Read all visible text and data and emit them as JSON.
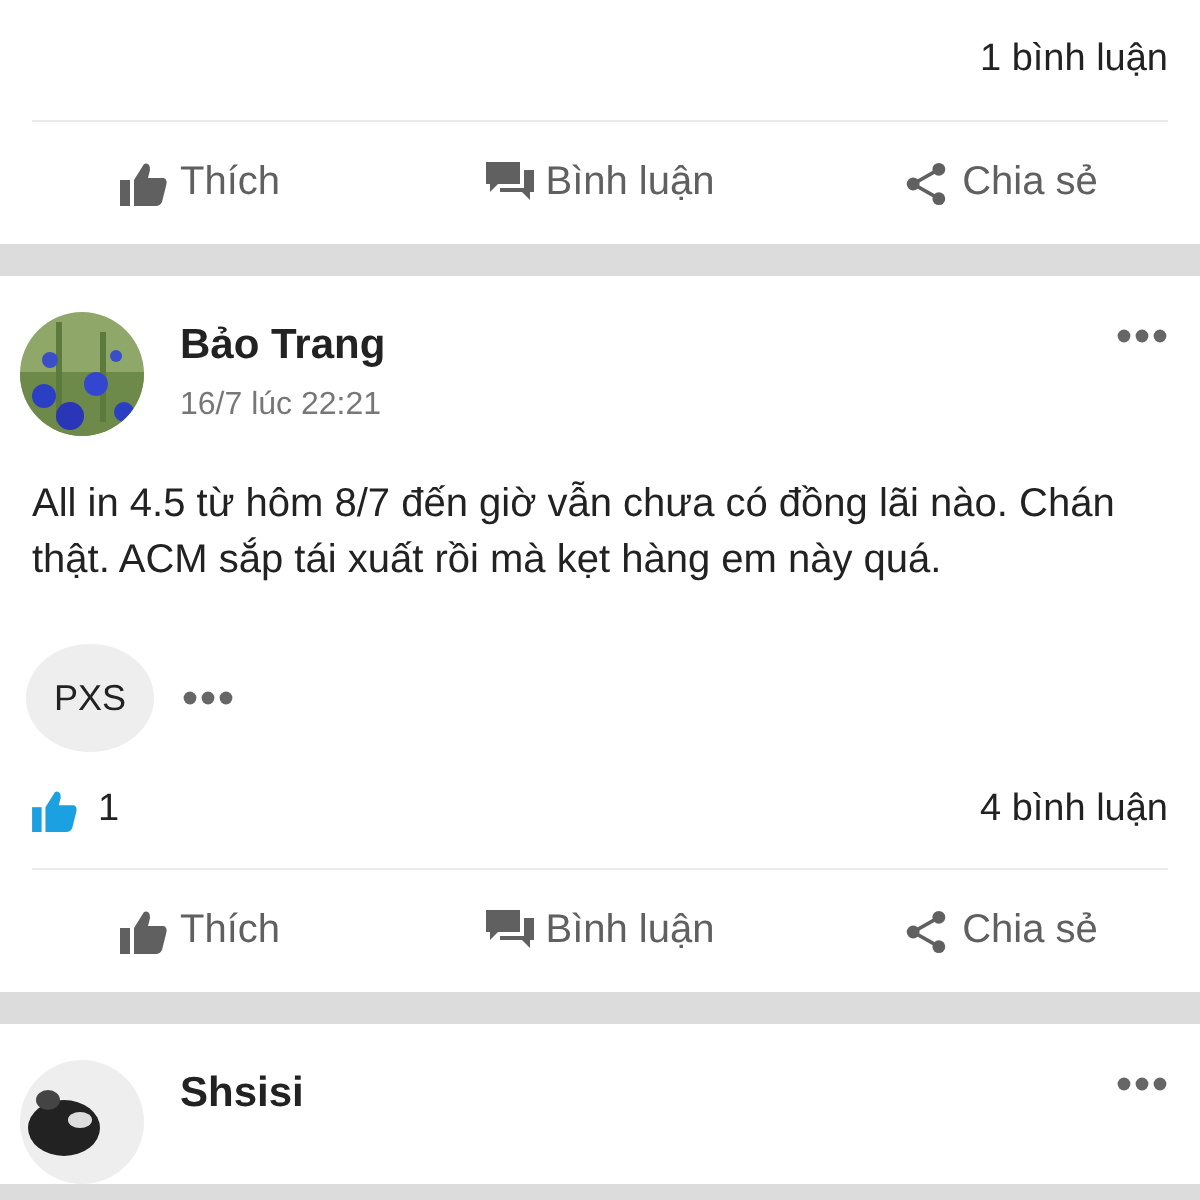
{
  "posts": [
    {
      "comment_count": "1 bình luận",
      "actions": [
        {
          "kind": "like",
          "label": "Thích"
        },
        {
          "kind": "comment",
          "label": "Bình luận"
        },
        {
          "kind": "share",
          "label": "Chia sẻ"
        }
      ]
    },
    {
      "author": "Bảo Trang",
      "time": "16/7 lúc 22:21",
      "text": "All in 4.5 từ hôm 8/7 đến giờ vẫn chưa có đồng lãi nào. Chán thật. ACM sắp tái xuất rồi mà kẹt hàng em này quá.",
      "tag": "PXS",
      "likes": "1",
      "comment_count": "4 bình luận",
      "actions": [
        {
          "kind": "like",
          "label": "Thích"
        },
        {
          "kind": "comment",
          "label": "Bình luận"
        },
        {
          "kind": "share",
          "label": "Chia sẻ"
        }
      ]
    },
    {
      "author": "Shsisi"
    }
  ]
}
